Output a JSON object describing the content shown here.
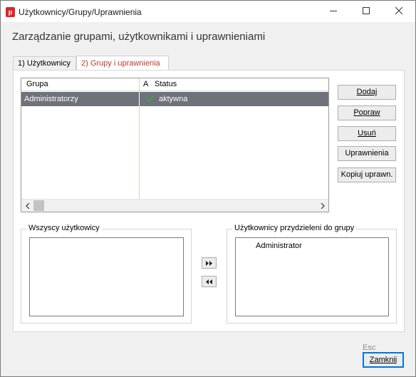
{
  "window": {
    "title": "Użytkownicy/Grupy/Uprawnienia",
    "app_icon_letter": "p"
  },
  "heading": "Zarządzanie grupami, użytkownikami i uprawnieniami",
  "tabs": [
    {
      "label": "1) Użytkownicy",
      "active": false
    },
    {
      "label": "2) Grupy i uprawnienia",
      "active": true
    }
  ],
  "groups_grid": {
    "columns": [
      "Grupa",
      "A",
      "Status"
    ],
    "rows": [
      {
        "grupa": "Administratorzy",
        "a": "✓",
        "status": "aktywna",
        "selected": true
      }
    ]
  },
  "side_buttons": [
    {
      "label": "Dodaj"
    },
    {
      "label": "Popraw"
    },
    {
      "label": "Usuń"
    },
    {
      "label": "Uprawnienia"
    },
    {
      "label": "Kopiuj uprawn."
    }
  ],
  "all_users": {
    "label": "Wszyscy użytkowicy",
    "items": []
  },
  "assigned_users": {
    "label": "Użytkownicy przydzieleni do grupy",
    "items": [
      "Administrator"
    ]
  },
  "move_buttons": {
    "add_all": "▸▸",
    "remove_all": "◂◂"
  },
  "footer": {
    "esc_hint": "Esc",
    "close_label": "Zamknij"
  },
  "colors": {
    "selection": "#6f727a",
    "active_tab_text": "#c0392b",
    "check": "#3aa845",
    "app_icon": "#d8262c"
  }
}
